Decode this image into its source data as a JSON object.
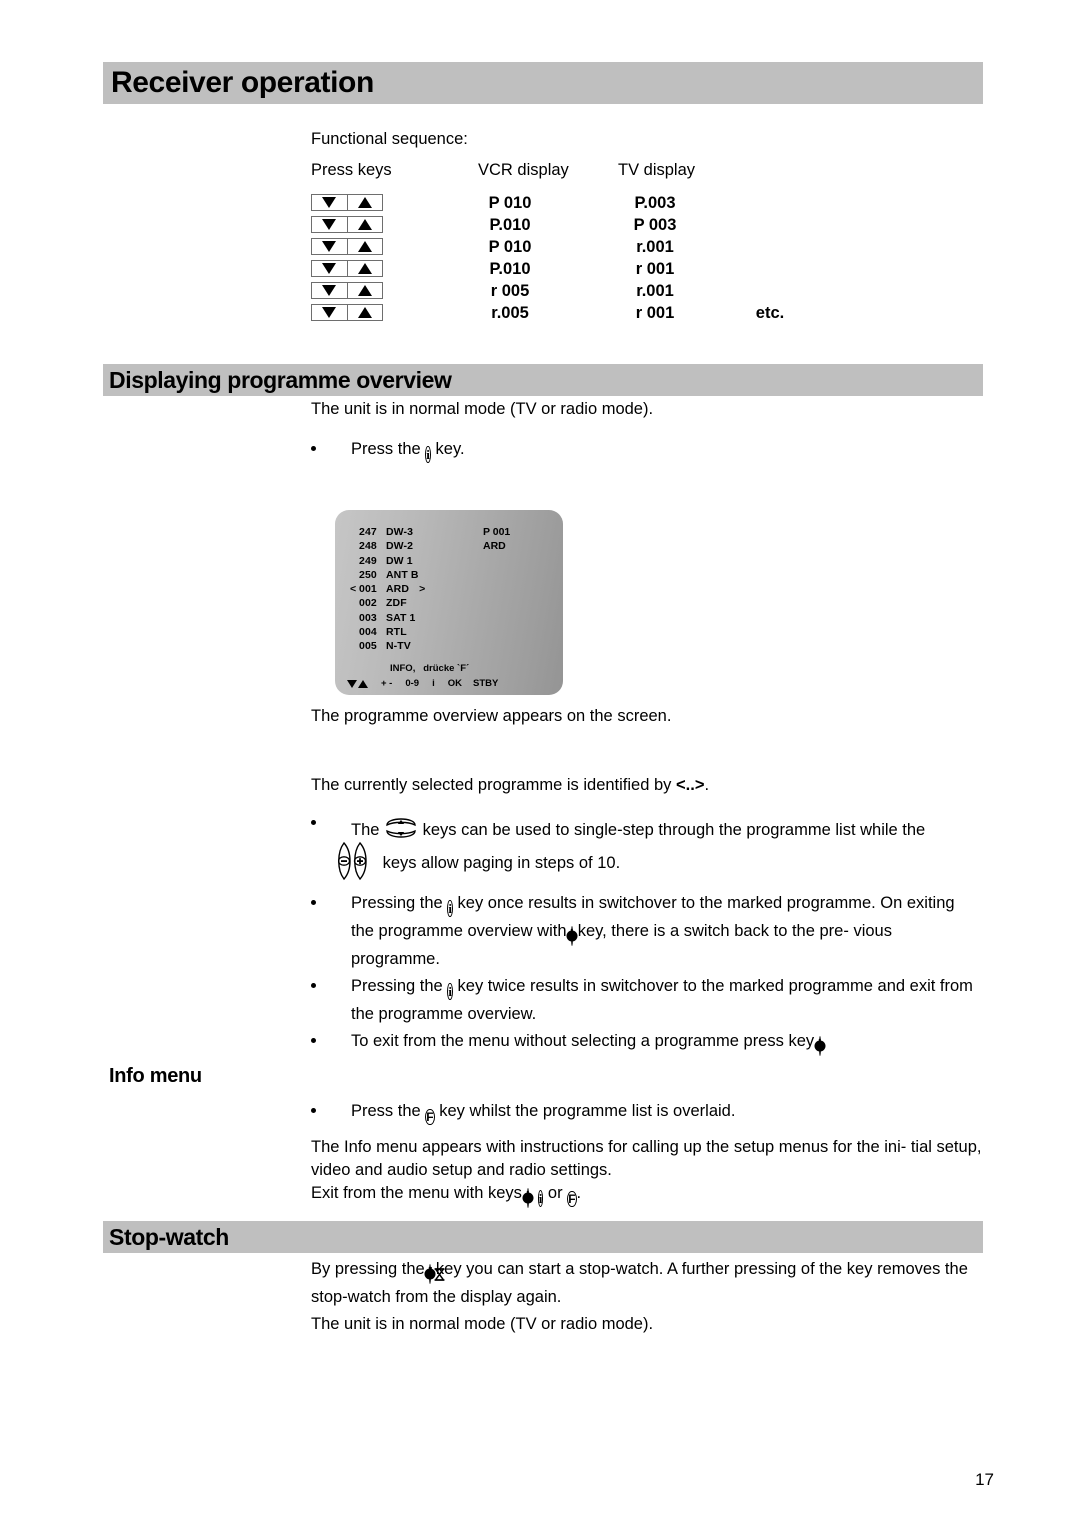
{
  "document": {
    "page_number": "17",
    "accent_bar_color": "#bfbfbf"
  },
  "headings": {
    "main": "Receiver operation",
    "programme_overview": "Displaying programme overview",
    "info_menu": "Info menu",
    "stop_watch": "Stop-watch"
  },
  "functional_sequence": {
    "intro": "Functional sequence:",
    "columns": [
      "Press keys",
      "VCR display",
      "TV display"
    ],
    "rows": [
      {
        "keys": "down-up-key-pair",
        "vcr": "P 010",
        "tv": "P.003",
        "note": ""
      },
      {
        "keys": "down-up-key-pair",
        "vcr": "P.010",
        "tv": "P 003",
        "note": ""
      },
      {
        "keys": "down-up-key-pair",
        "vcr": "P 010",
        "tv": "r.001",
        "note": ""
      },
      {
        "keys": "down-up-key-pair",
        "vcr": "P.010",
        "tv": "r 001",
        "note": ""
      },
      {
        "keys": "down-up-key-pair",
        "vcr": "r 005",
        "tv": "r.001",
        "note": ""
      },
      {
        "keys": "down-up-key-pair",
        "vcr": "r.005",
        "tv": "r 001",
        "note": "etc."
      }
    ]
  },
  "programme_overview": {
    "intro": "The unit is in normal mode (TV or radio mode).",
    "press_key_before": "Press the",
    "press_key_after": "key.",
    "appears": "The programme overview appears on the screen.",
    "identified_before": "The currently selected programme is identified by",
    "identified_marker": "<..>",
    "identified_after": ".",
    "bullets": {
      "b1_p1": "The",
      "b1_p2": "keys can be used to single-step through the programme list while the",
      "b1_p3": "keys allow paging in steps of 10.",
      "b2_p1": "Pressing the",
      "b2_p2": "key once results in switchover to the marked programme. On exiting the programme overview with",
      "b2_p3": "key, there is a switch back to the pre-",
      "b2_p4": "vious programme.",
      "b3_p1": "Pressing the",
      "b3_p2": "key twice results in switchover to the marked programme and",
      "b3_p3": "exit from the programme overview.",
      "b4_p1": "To exit from the menu without selecting a programme press key",
      "b4_p2": "."
    }
  },
  "tv_screen": {
    "channels": [
      {
        "marker_left": "",
        "number": "247",
        "name": "DW-3",
        "marker_right": ""
      },
      {
        "marker_left": "",
        "number": "248",
        "name": "DW-2",
        "marker_right": ""
      },
      {
        "marker_left": "",
        "number": "249",
        "name": "DW 1",
        "marker_right": ""
      },
      {
        "marker_left": "",
        "number": "250",
        "name": "ANT B",
        "marker_right": ""
      },
      {
        "marker_left": "<",
        "number": "001",
        "name": "ARD",
        "marker_right": ">"
      },
      {
        "marker_left": "",
        "number": "002",
        "name": "ZDF",
        "marker_right": ""
      },
      {
        "marker_left": "",
        "number": "003",
        "name": "SAT 1",
        "marker_right": ""
      },
      {
        "marker_left": "",
        "number": "004",
        "name": "RTL",
        "marker_right": ""
      },
      {
        "marker_left": "",
        "number": "005",
        "name": "N-TV",
        "marker_right": ""
      }
    ],
    "current_programme_number": "P 001",
    "current_programme_name": "ARD",
    "info_line": "INFO,   drücke `F´",
    "bottom_bar": [
      "+ -",
      "0-9",
      "i",
      "OK",
      "STBY"
    ]
  },
  "info_menu": {
    "bullet_p1": "Press the",
    "bullet_p2": "key whilst the programme list is overlaid.",
    "para_line1": "The Info menu appears with instructions for calling up the setup menus for the ini-",
    "para_line2": "tial setup, video and audio setup and radio settings.",
    "exit_p1": "Exit from the menu with keys",
    "exit_sep1": ",",
    "exit_sep2": "or",
    "exit_p2": "."
  },
  "stop_watch": {
    "line1_p1": "By pressing the",
    "line1_p2": "key you can start a stop-watch. A further pressing of the key",
    "line2": "removes the stop-watch from the display again.",
    "line3": "The unit is in normal mode (TV or radio mode)."
  },
  "icons": {
    "info_key": "i",
    "function_key": "F",
    "power_key": "power-symbol",
    "stopwatch_key": "hourglass",
    "down_key": "triangle-down",
    "up_key": "triangle-up",
    "minus_key": "−",
    "plus_key": "+"
  }
}
